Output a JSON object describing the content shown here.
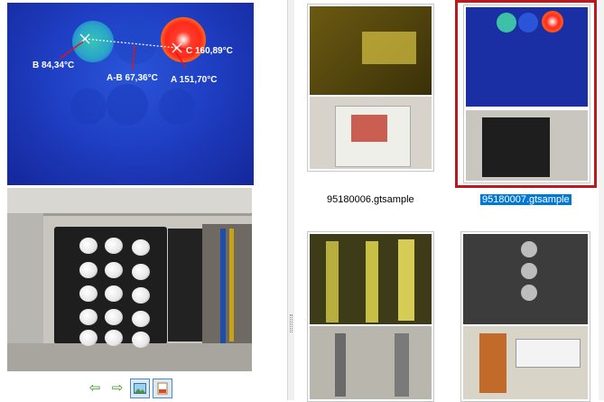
{
  "thermal": {
    "labels": {
      "b": "B 84,34°C",
      "ab": "A-B 67,36°C",
      "c": "C 160,89°C",
      "a": "A 151,70°C"
    }
  },
  "toolbar": {
    "prev_icon": "green-left-arrow",
    "next_icon": "green-right-arrow",
    "image_icon": "image-icon",
    "report_icon": "report-icon"
  },
  "thumbnails": [
    {
      "filename": "95180006.gtsample",
      "selected": false
    },
    {
      "filename": "95180007.gtsample",
      "selected": true
    },
    {
      "filename": "",
      "selected": false
    },
    {
      "filename": "",
      "selected": false
    }
  ],
  "colors": {
    "selection_border": "#c0171f",
    "selection_fill": "#0078d7"
  }
}
